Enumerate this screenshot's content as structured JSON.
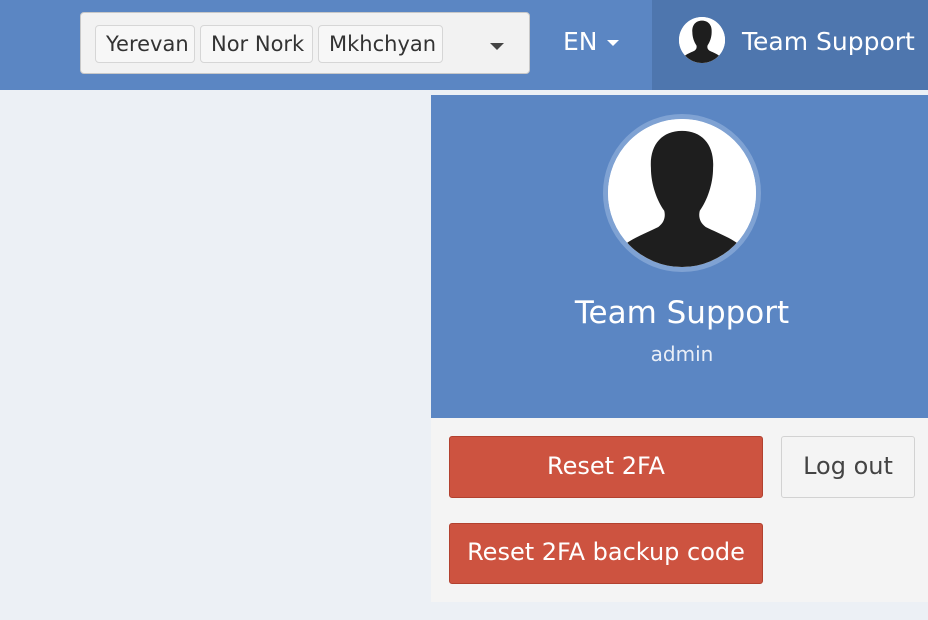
{
  "header": {
    "location_tags": [
      "Yerevan",
      "Nor Nork",
      "Mkhchyan"
    ],
    "language": "EN",
    "user_name": "Team Support"
  },
  "profile": {
    "name": "Team Support",
    "role": "admin"
  },
  "actions": {
    "reset_2fa": "Reset 2FA",
    "logout": "Log out",
    "reset_2fa_backup": "Reset 2FA backup code"
  },
  "colors": {
    "header_bg": "#5b86c3",
    "user_menu_bg": "#4e76ae",
    "danger": "#cd5340",
    "page_bg": "#ecf0f5"
  },
  "icons": {
    "avatar": "user-silhouette-icon",
    "select_caret": "caret-down-icon",
    "language_caret": "caret-down-icon"
  }
}
